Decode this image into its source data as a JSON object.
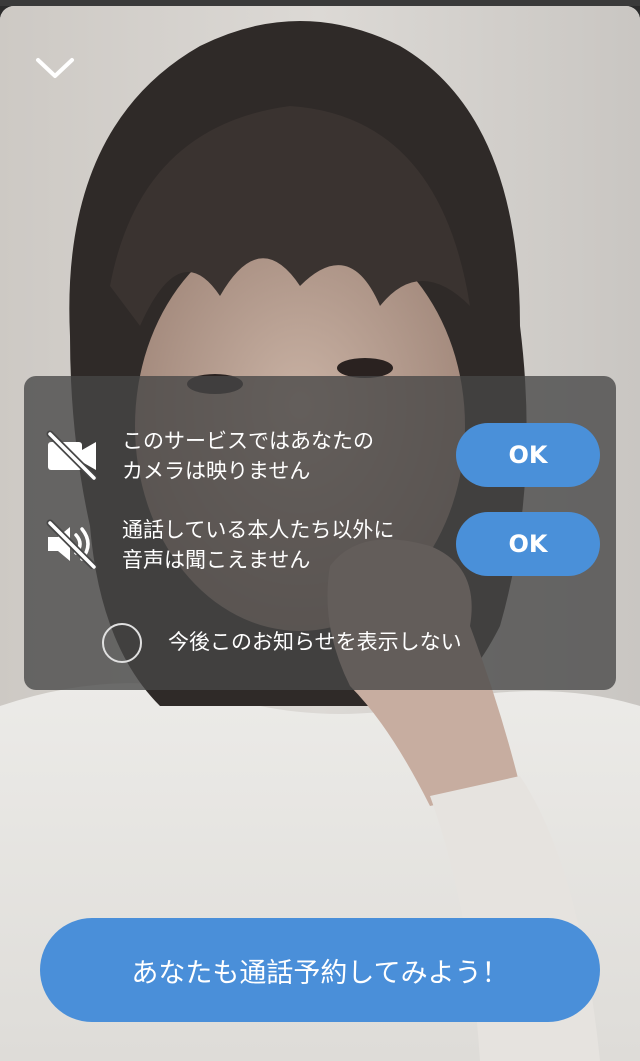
{
  "header": {
    "collapse_icon": "chevron-down-icon"
  },
  "notices": {
    "camera": {
      "icon": "camera-off-icon",
      "text": "このサービスではあなたの\nカメラは映りません",
      "ok_label": "OK"
    },
    "audio": {
      "icon": "speaker-muted-icon",
      "text": "通話している本人たち以外に\n音声は聞こえません",
      "ok_label": "OK"
    },
    "dont_show_again": {
      "label": "今後このお知らせを表示しない",
      "checked": false
    }
  },
  "cta": {
    "label": "あなたも通話予約してみよう！"
  },
  "colors": {
    "accent": "#4a90d9",
    "panel_overlay": "rgba(70,70,70,0.78)",
    "text": "#ffffff"
  }
}
